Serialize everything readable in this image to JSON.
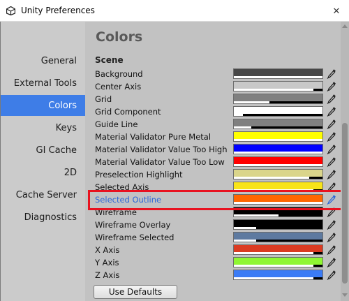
{
  "window": {
    "title": "Unity Preferences",
    "close_glyph": "✕"
  },
  "sidebar": {
    "items": [
      {
        "label": "General",
        "selected": false
      },
      {
        "label": "External Tools",
        "selected": false
      },
      {
        "label": "Colors",
        "selected": true
      },
      {
        "label": "Keys",
        "selected": false
      },
      {
        "label": "GI Cache",
        "selected": false
      },
      {
        "label": "2D",
        "selected": false
      },
      {
        "label": "Cache Server",
        "selected": false
      },
      {
        "label": "Diagnostics",
        "selected": false
      }
    ]
  },
  "main": {
    "title": "Colors",
    "section": "Scene",
    "rows": [
      {
        "label": "Background",
        "color": "#474747",
        "alpha": 1.0
      },
      {
        "label": "Center Axis",
        "color": "#c8c8c8",
        "alpha": 0.9
      },
      {
        "label": "Grid",
        "color": "#808080",
        "alpha": 0.4
      },
      {
        "label": "Grid Component",
        "color": "#ffffff",
        "alpha": 0.1
      },
      {
        "label": "Guide Line",
        "color": "#808080",
        "alpha": 0.2
      },
      {
        "label": "Material Validator Pure Metal",
        "color": "#ffff00",
        "alpha": 1.0
      },
      {
        "label": "Material Validator Value Too High",
        "color": "#0000ff",
        "alpha": 1.0
      },
      {
        "label": "Material Validator Value Too Low",
        "color": "#ff0000",
        "alpha": 1.0
      },
      {
        "label": "Preselection Highlight",
        "color": "#dad58b",
        "alpha": 0.85
      },
      {
        "label": "Selected Axis",
        "color": "#f8e419",
        "alpha": 0.9
      },
      {
        "label": "Selected Outline",
        "color": "#ff6600",
        "alpha": 1.0,
        "selected": true
      },
      {
        "label": "Wireframe",
        "color": "#000000",
        "alpha": 0.5
      },
      {
        "label": "Wireframe Overlay",
        "color": "#000000",
        "alpha": 0.25
      },
      {
        "label": "Wireframe Selected",
        "color": "#5e7aa0",
        "alpha": 0.25
      },
      {
        "label": "X Axis",
        "color": "#db3b21",
        "alpha": 0.9
      },
      {
        "label": "Y Axis",
        "color": "#8ff632",
        "alpha": 0.9
      },
      {
        "label": "Z Axis",
        "color": "#3b7bf5",
        "alpha": 0.9
      }
    ],
    "use_defaults_label": "Use Defaults"
  },
  "colors": {
    "accent": "#3e7de7",
    "highlight_box": "#e8121f",
    "selected_label": "#2a66d8"
  }
}
